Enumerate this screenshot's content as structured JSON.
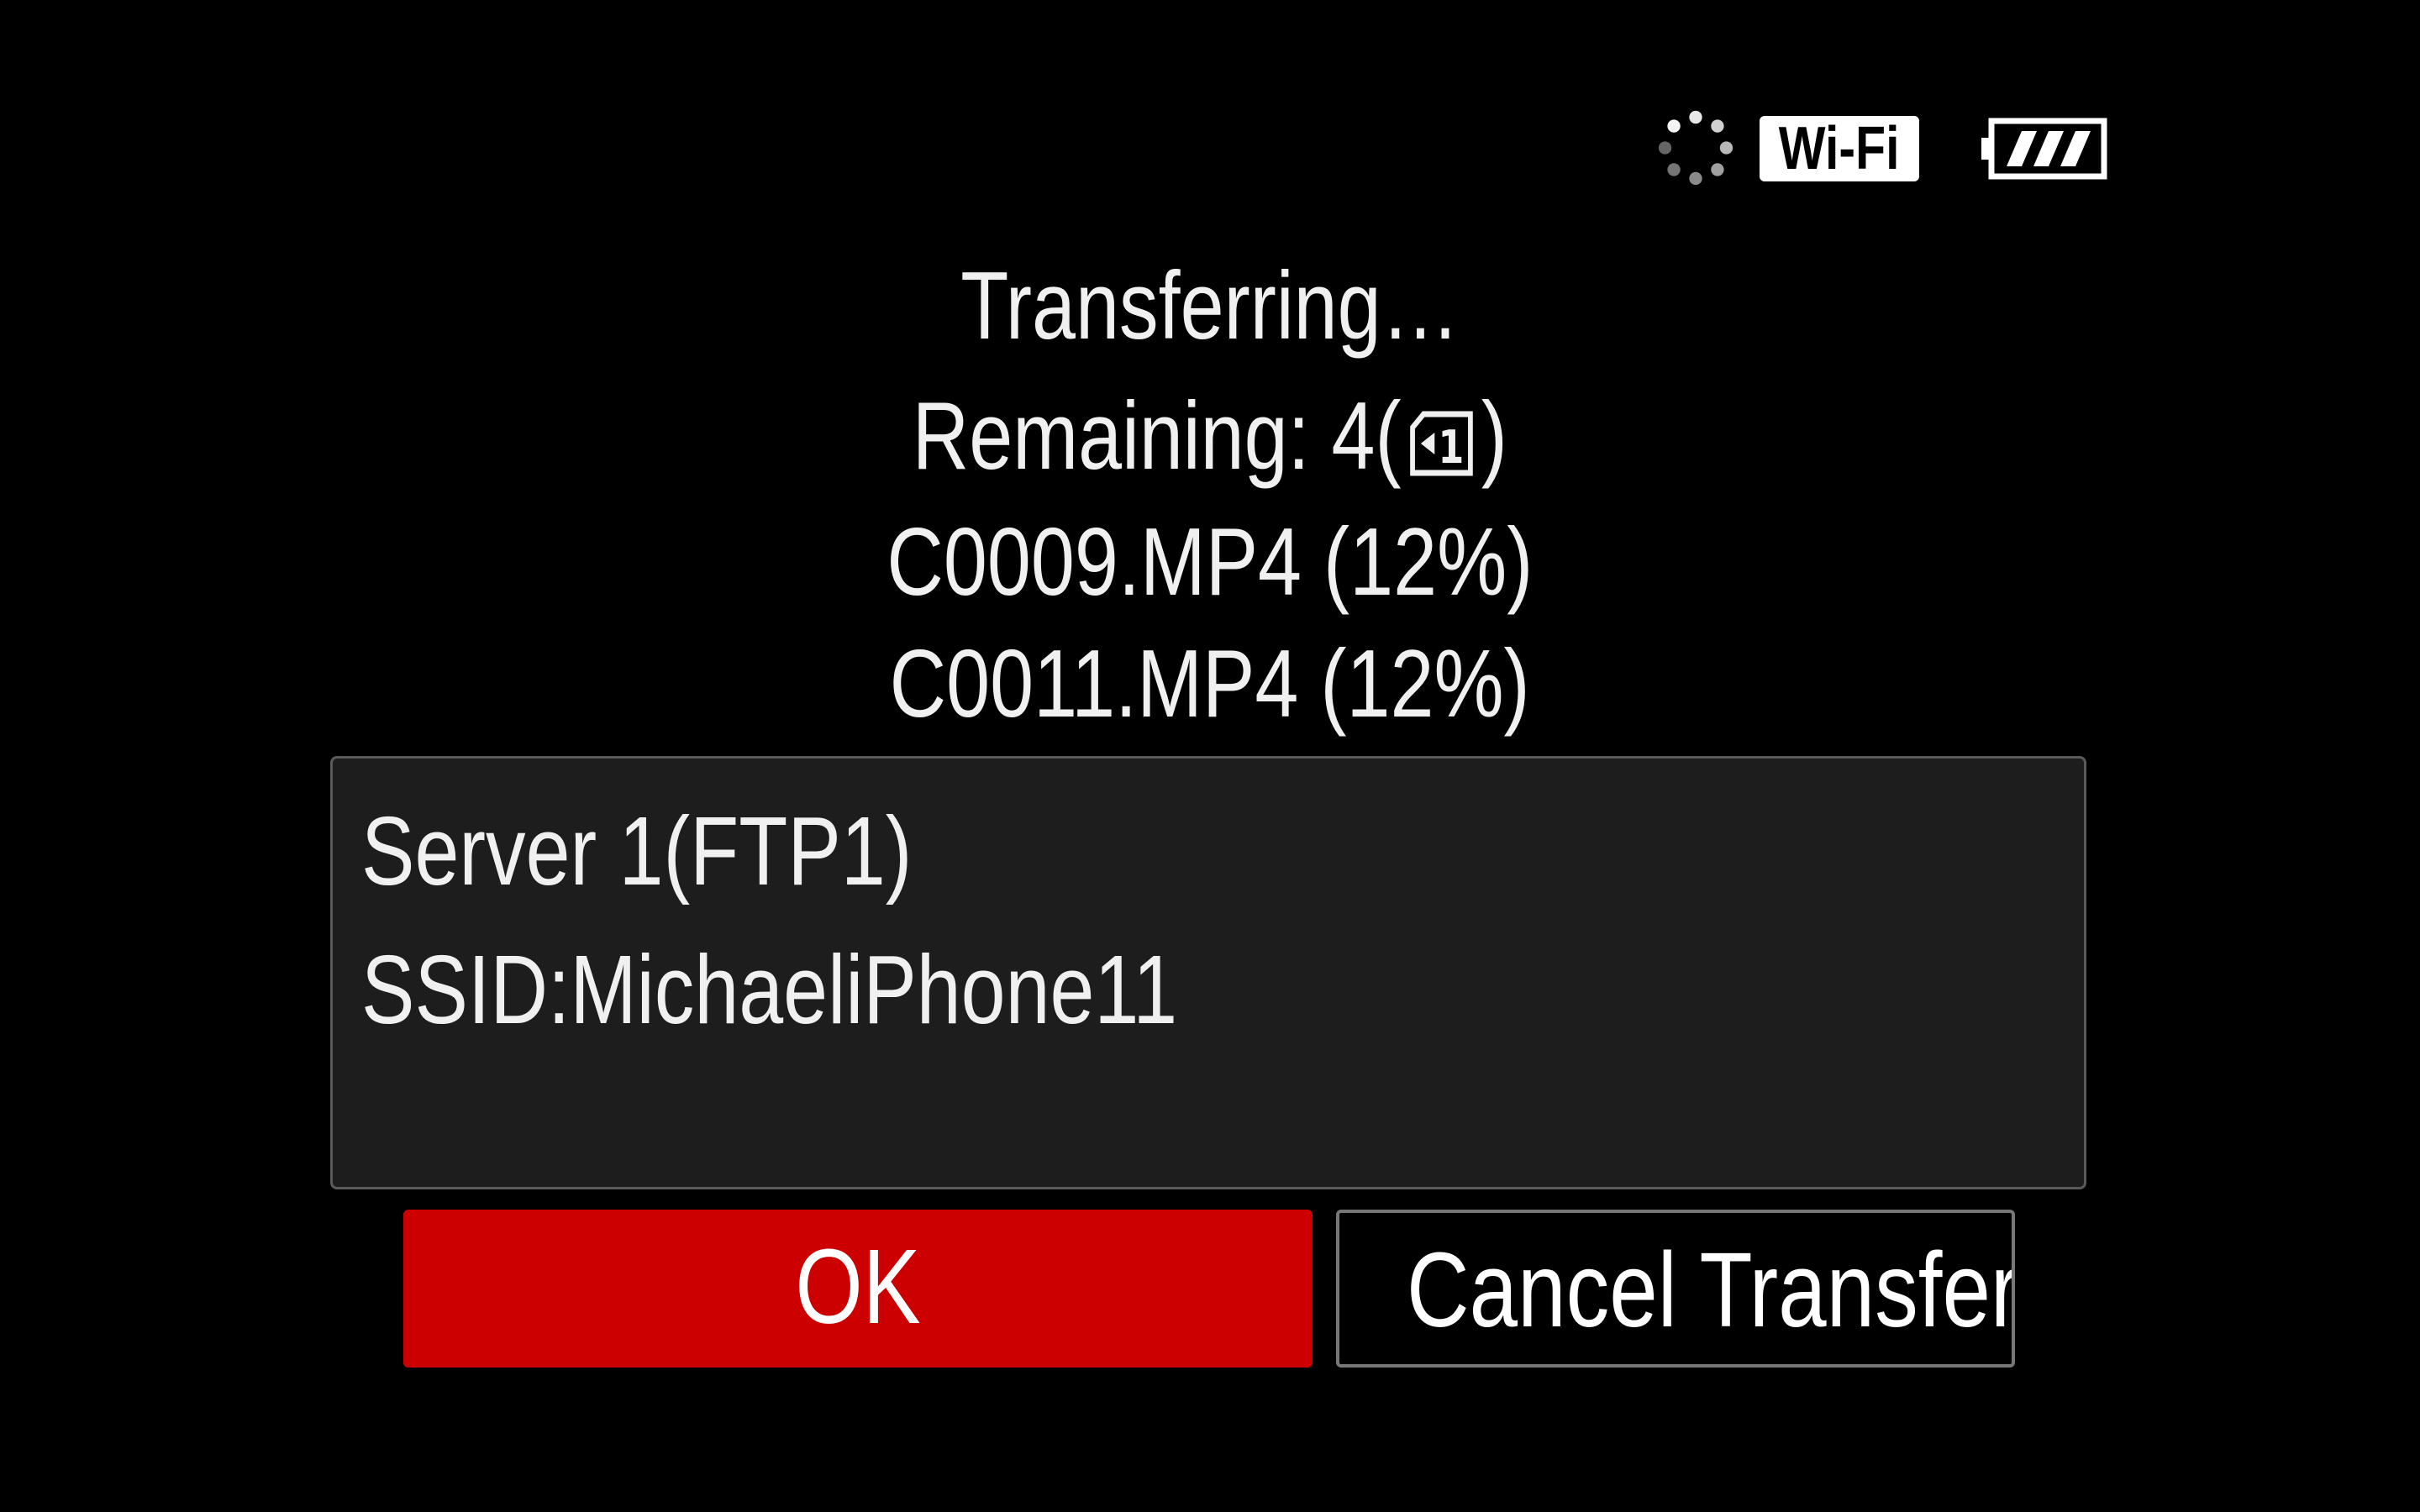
{
  "status_bar": {
    "activity_icon": "loading-spinner-icon",
    "wifi_label": "Wi-Fi",
    "battery_icon": "battery-full-icon",
    "battery_level": 1.0
  },
  "transfer": {
    "title": "Transferring…",
    "remaining_label": "Remaining:",
    "remaining_count": "4(",
    "remaining_close": ")",
    "media_slot_icon": "media-slot-1-icon",
    "media_slot_number": "1",
    "files": [
      {
        "name": "C0009.MP4",
        "progress": "(12%)"
      },
      {
        "name": "C0011.MP4",
        "progress": "(12%)"
      }
    ]
  },
  "info": {
    "server": "Server 1(FTP1)",
    "ssid": "SSID:MichaeliPhone11"
  },
  "buttons": {
    "ok_label": "OK",
    "cancel_label": "Cancel Transfer"
  },
  "colors": {
    "background": "#000000",
    "ok_button": "#cc0000",
    "info_box": "#1d1d1d"
  }
}
